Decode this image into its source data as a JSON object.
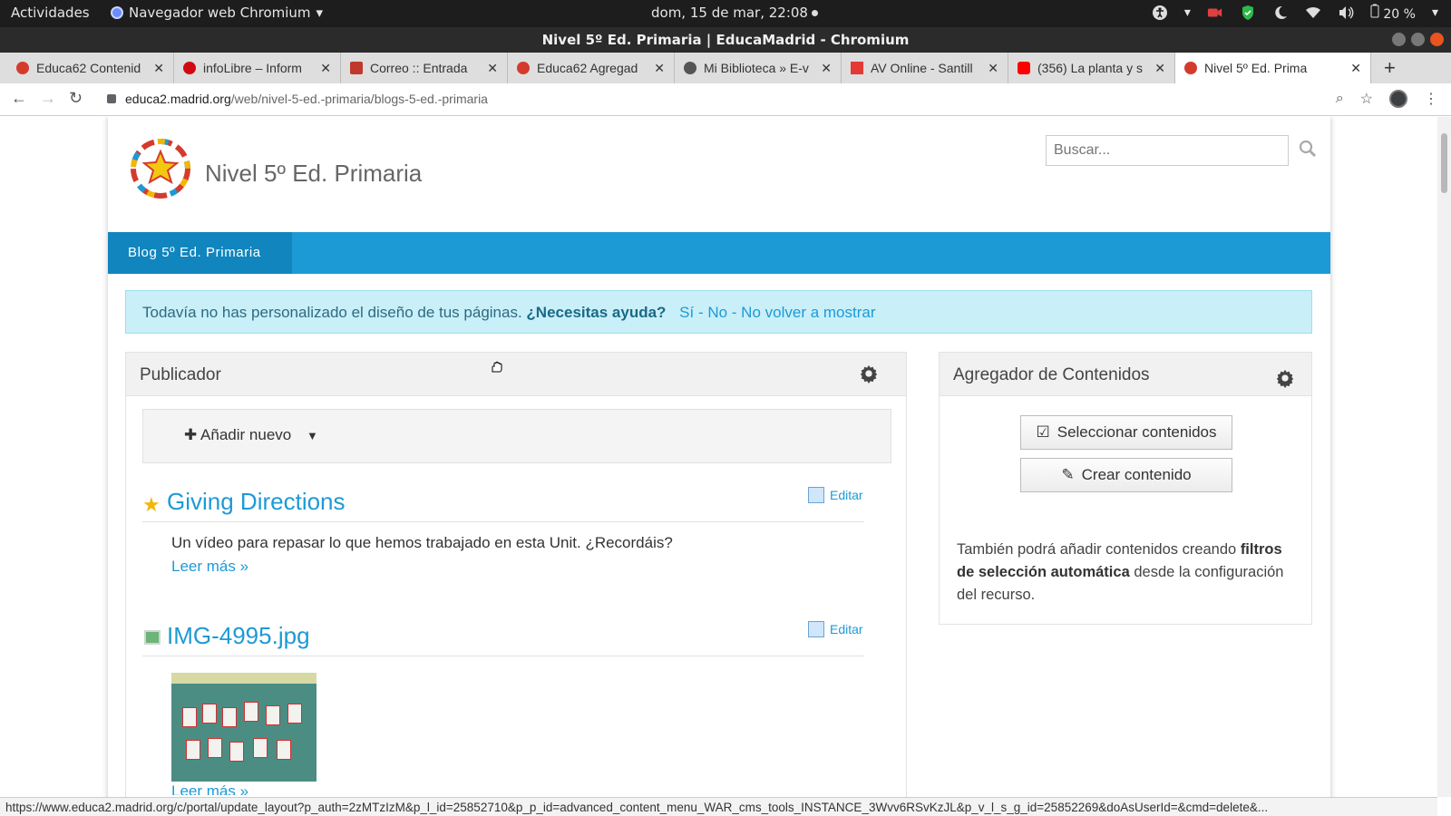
{
  "topbar": {
    "activities": "Actividades",
    "app_name": "Navegador web Chromium",
    "clock": "dom, 15 de mar, 22:08",
    "battery": "20 %"
  },
  "window": {
    "title": "Nivel 5º Ed. Primaria | EducaMadrid - Chromium"
  },
  "tabs": [
    {
      "label": "Educa62 Contenid",
      "favicon_color": "#d43b2d"
    },
    {
      "label": "infoLibre – Inform",
      "favicon_color": "#d10a11"
    },
    {
      "label": "Correo :: Entrada",
      "favicon_color": "#c0392b"
    },
    {
      "label": "Educa62 Agregad",
      "favicon_color": "#d43b2d"
    },
    {
      "label": "Mi Biblioteca » E-v",
      "favicon_color": "#555555"
    },
    {
      "label": "AV Online - Santill",
      "favicon_color": "#e53935"
    },
    {
      "label": "(356) La planta y s",
      "favicon_color": "#ff0000"
    },
    {
      "label": "Nivel 5º Ed. Prima",
      "favicon_color": "#d43b2d"
    }
  ],
  "address": {
    "domain": "educa2.madrid.org",
    "path": "/web/nivel-5-ed.-primaria/blogs-5-ed.-primaria"
  },
  "site": {
    "name": "Nivel 5º Ed. Primaria",
    "search_placeholder": "Buscar...",
    "nav_item": "Blog 5º Ed. Primaria"
  },
  "alert": {
    "text": "Todavía no has personalizado el diseño de tus páginas.",
    "help": "¿Necesitas ayuda?",
    "links": "Sí - No - No volver a mostrar"
  },
  "publisher": {
    "title": "Publicador",
    "add_new": "Añadir nuevo",
    "entries": [
      {
        "title": "Giving Directions",
        "edit": "Editar",
        "summary": "Un vídeo para repasar lo que hemos trabajado en esta Unit. ¿Recordáis?",
        "read_more": "Leer más »"
      },
      {
        "title": "IMG-4995.jpg",
        "edit": "Editar",
        "read_more": "Leer más »"
      }
    ]
  },
  "aggregator": {
    "title": "Agregador de Contenidos",
    "select_button": "Seleccionar contenidos",
    "create_button": "Crear contenido",
    "info_prefix": "También podrá añadir contenidos creando",
    "info_bold": "filtros de selección automática",
    "info_suffix": "desde la configuración del recurso."
  },
  "status_url": "https://www.educa2.madrid.org/c/portal/update_layout?p_auth=2zMTzIzM&p_l_id=25852710&p_p_id=advanced_content_menu_WAR_cms_tools_INSTANCE_3Wvv6RSvKzJL&p_v_l_s_g_id=25852269&doAsUserId=&cmd=delete&..."
}
